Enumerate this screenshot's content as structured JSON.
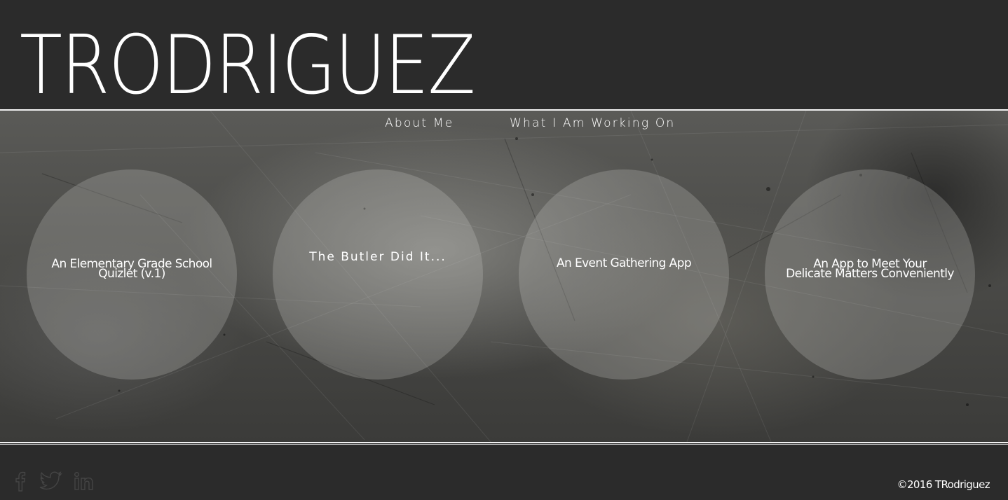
{
  "header": {
    "site_title": "TRODRIGUEZ"
  },
  "nav": {
    "items": [
      {
        "label": "About Me"
      },
      {
        "label": "What I Am Working On"
      }
    ]
  },
  "projects": [
    {
      "line1": "An Elementary Grade School",
      "line2": "Quizlet (v.1)"
    },
    {
      "line1": "The Butler Did It...",
      "line2": ""
    },
    {
      "line1": "An Event Gathering App",
      "line2": ""
    },
    {
      "line1": "An App to Meet Your",
      "line2": "Delicate Matters Conveniently"
    }
  ],
  "footer": {
    "social": [
      {
        "icon": "facebook-icon"
      },
      {
        "icon": "twitter-icon"
      },
      {
        "icon": "linkedin-icon"
      }
    ],
    "copyright": "©2016 TRodriguez"
  },
  "colors": {
    "background": "#2b2b2b",
    "text": "#ffffff",
    "circle_fill": "rgba(200,200,198,0.26)",
    "social_icon": "#444444"
  }
}
